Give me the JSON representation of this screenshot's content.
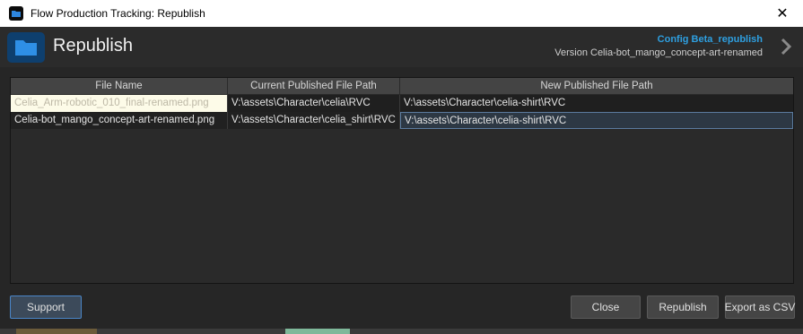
{
  "window": {
    "title": "Flow Production Tracking: Republish",
    "close_glyph": "✕"
  },
  "header": {
    "title": "Republish",
    "config_label": "Config Beta_republish",
    "version_label": "Version Celia-bot_mango_concept-art-renamed",
    "icon": "folder-icon",
    "accent_color": "#2e9fe0"
  },
  "table": {
    "columns": [
      "File Name",
      "Current Published File Path",
      "New Published File Path"
    ],
    "rows": [
      [
        "Celia_Arm-robotic_010_final-renamed.png",
        "V:\\assets\\Character\\celia\\RVC",
        "V:\\assets\\Character\\celia-shirt\\RVC"
      ],
      [
        "Celia-bot_mango_concept-art-renamed.png",
        "V:\\assets\\Character\\celia_shirt\\RVC",
        "V:\\assets\\Character\\celia-shirt\\RVC"
      ]
    ]
  },
  "footer": {
    "support_label": "Support",
    "close_label": "Close",
    "republish_label": "Republish",
    "export_label": "Export as CSV"
  }
}
